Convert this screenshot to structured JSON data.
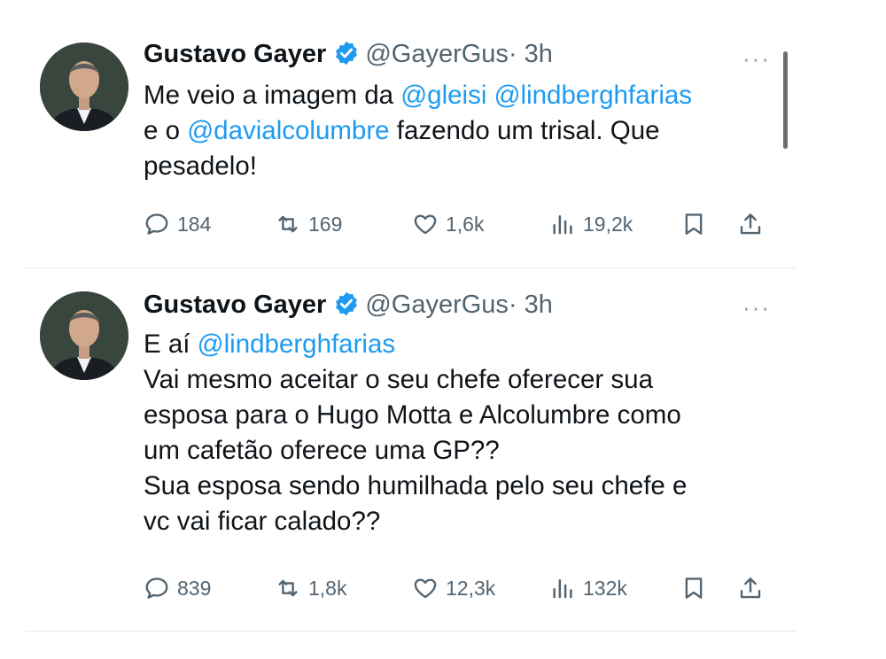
{
  "colors": {
    "link": "#1d9bf0",
    "muted": "#536471",
    "verified": "#1d9bf0"
  },
  "tweets": [
    {
      "author": {
        "name": "Gustavo Gayer",
        "handle": "@GayerGus",
        "time": "· 3h"
      },
      "more": "···",
      "line1": {
        "text1": "Me veio a imagem da ",
        "mention1": "@gleisi",
        "space": " ",
        "mention2": "@lindberghfarias"
      },
      "line2": {
        "text1": "e o ",
        "mention1": "@davialcolumbre",
        "text2": " fazendo um trisal. Que"
      },
      "line3": "pesadelo!",
      "stats": {
        "replies": "184",
        "reposts": "169",
        "likes": "1,6k",
        "views": "19,2k"
      }
    },
    {
      "author": {
        "name": "Gustavo Gayer",
        "handle": "@GayerGus",
        "time": "· 3h"
      },
      "more": "···",
      "line1": {
        "text1": "E aí ",
        "mention1": "@lindberghfarias"
      },
      "line2": "Vai mesmo aceitar o seu chefe oferecer sua",
      "line3": "esposa para o Hugo Motta e Alcolumbre como",
      "line4": "um cafetão oferece uma GP??",
      "line5": "Sua esposa sendo humilhada pelo seu chefe e",
      "line6": "vc vai ficar calado??",
      "stats": {
        "replies": "839",
        "reposts": "1,8k",
        "likes": "12,3k",
        "views": "132k"
      }
    }
  ]
}
